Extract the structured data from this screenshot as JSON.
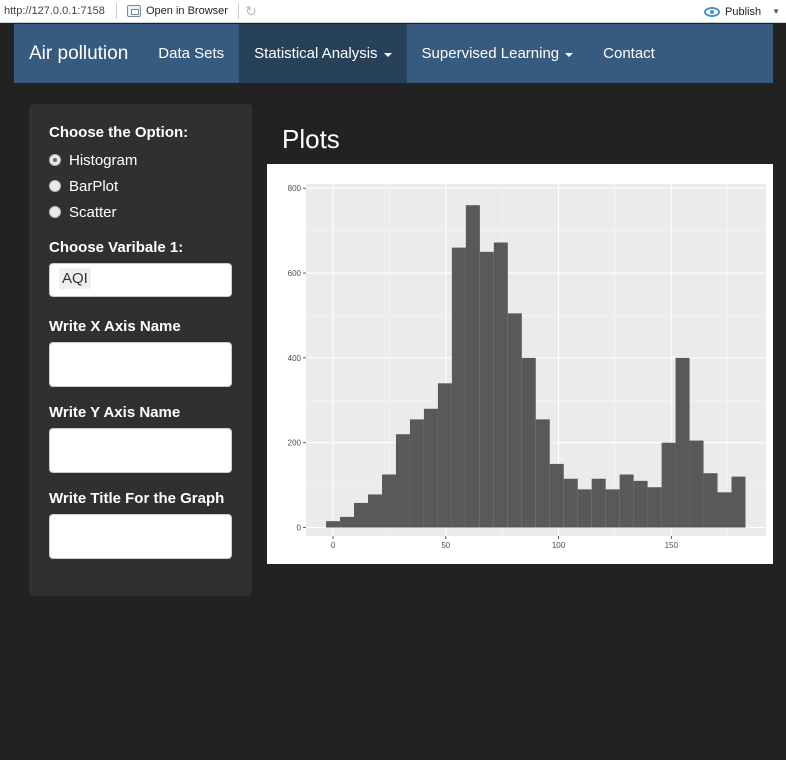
{
  "viewer": {
    "url": "http://127.0.0.1:7158",
    "open_in_browser": "Open in Browser",
    "publish": "Publish"
  },
  "navbar": {
    "brand": "Air pollution",
    "items": [
      {
        "label": "Data Sets",
        "active": false,
        "dropdown": false
      },
      {
        "label": "Statistical Analysis",
        "active": true,
        "dropdown": true
      },
      {
        "label": "Supervised Learning",
        "active": false,
        "dropdown": true
      },
      {
        "label": "Contact",
        "active": false,
        "dropdown": false
      }
    ]
  },
  "sidebar": {
    "option_label": "Choose the Option:",
    "options": [
      "Histogram",
      "BarPlot",
      "Scatter"
    ],
    "selected_option": "Histogram",
    "var1_label": "Choose Varibale 1:",
    "var1_value": "AQI",
    "xaxis_label": "Write X Axis Name",
    "xaxis_value": "",
    "yaxis_label": "Write Y Axis Name",
    "yaxis_value": "",
    "title_label": "Write Title For the Graph",
    "title_value": ""
  },
  "main": {
    "title": "Plots"
  },
  "colors": {
    "navbar": "#375a7f",
    "navbar_active": "#28415b",
    "background": "#222222",
    "sidebar": "#303030",
    "bar_fill": "#595959",
    "panel_bg": "#ebebeb"
  },
  "chart_data": {
    "type": "bar",
    "title": "",
    "xlabel": "",
    "ylabel": "",
    "bin_width": 6.2,
    "bin_centers": [
      0,
      6.2,
      12.4,
      18.6,
      24.8,
      31,
      37.2,
      43.4,
      49.6,
      55.8,
      62,
      68.2,
      74.4,
      80.6,
      86.8,
      93,
      99.2,
      105.4,
      111.6,
      117.8,
      124,
      130.2,
      136.4,
      142.6,
      148.8,
      155,
      161.2,
      167.4,
      173.6,
      179.8
    ],
    "values": [
      15,
      25,
      58,
      78,
      125,
      220,
      255,
      280,
      340,
      660,
      760,
      650,
      672,
      505,
      400,
      255,
      150,
      115,
      90,
      115,
      90,
      125,
      110,
      95,
      200,
      400,
      205,
      128,
      83,
      120
    ],
    "xlim": [
      -12,
      192
    ],
    "ylim": [
      -20,
      810
    ],
    "x_ticks": [
      0,
      50,
      100,
      150
    ],
    "y_ticks": [
      0,
      200,
      400,
      600,
      800
    ],
    "grid": true
  }
}
